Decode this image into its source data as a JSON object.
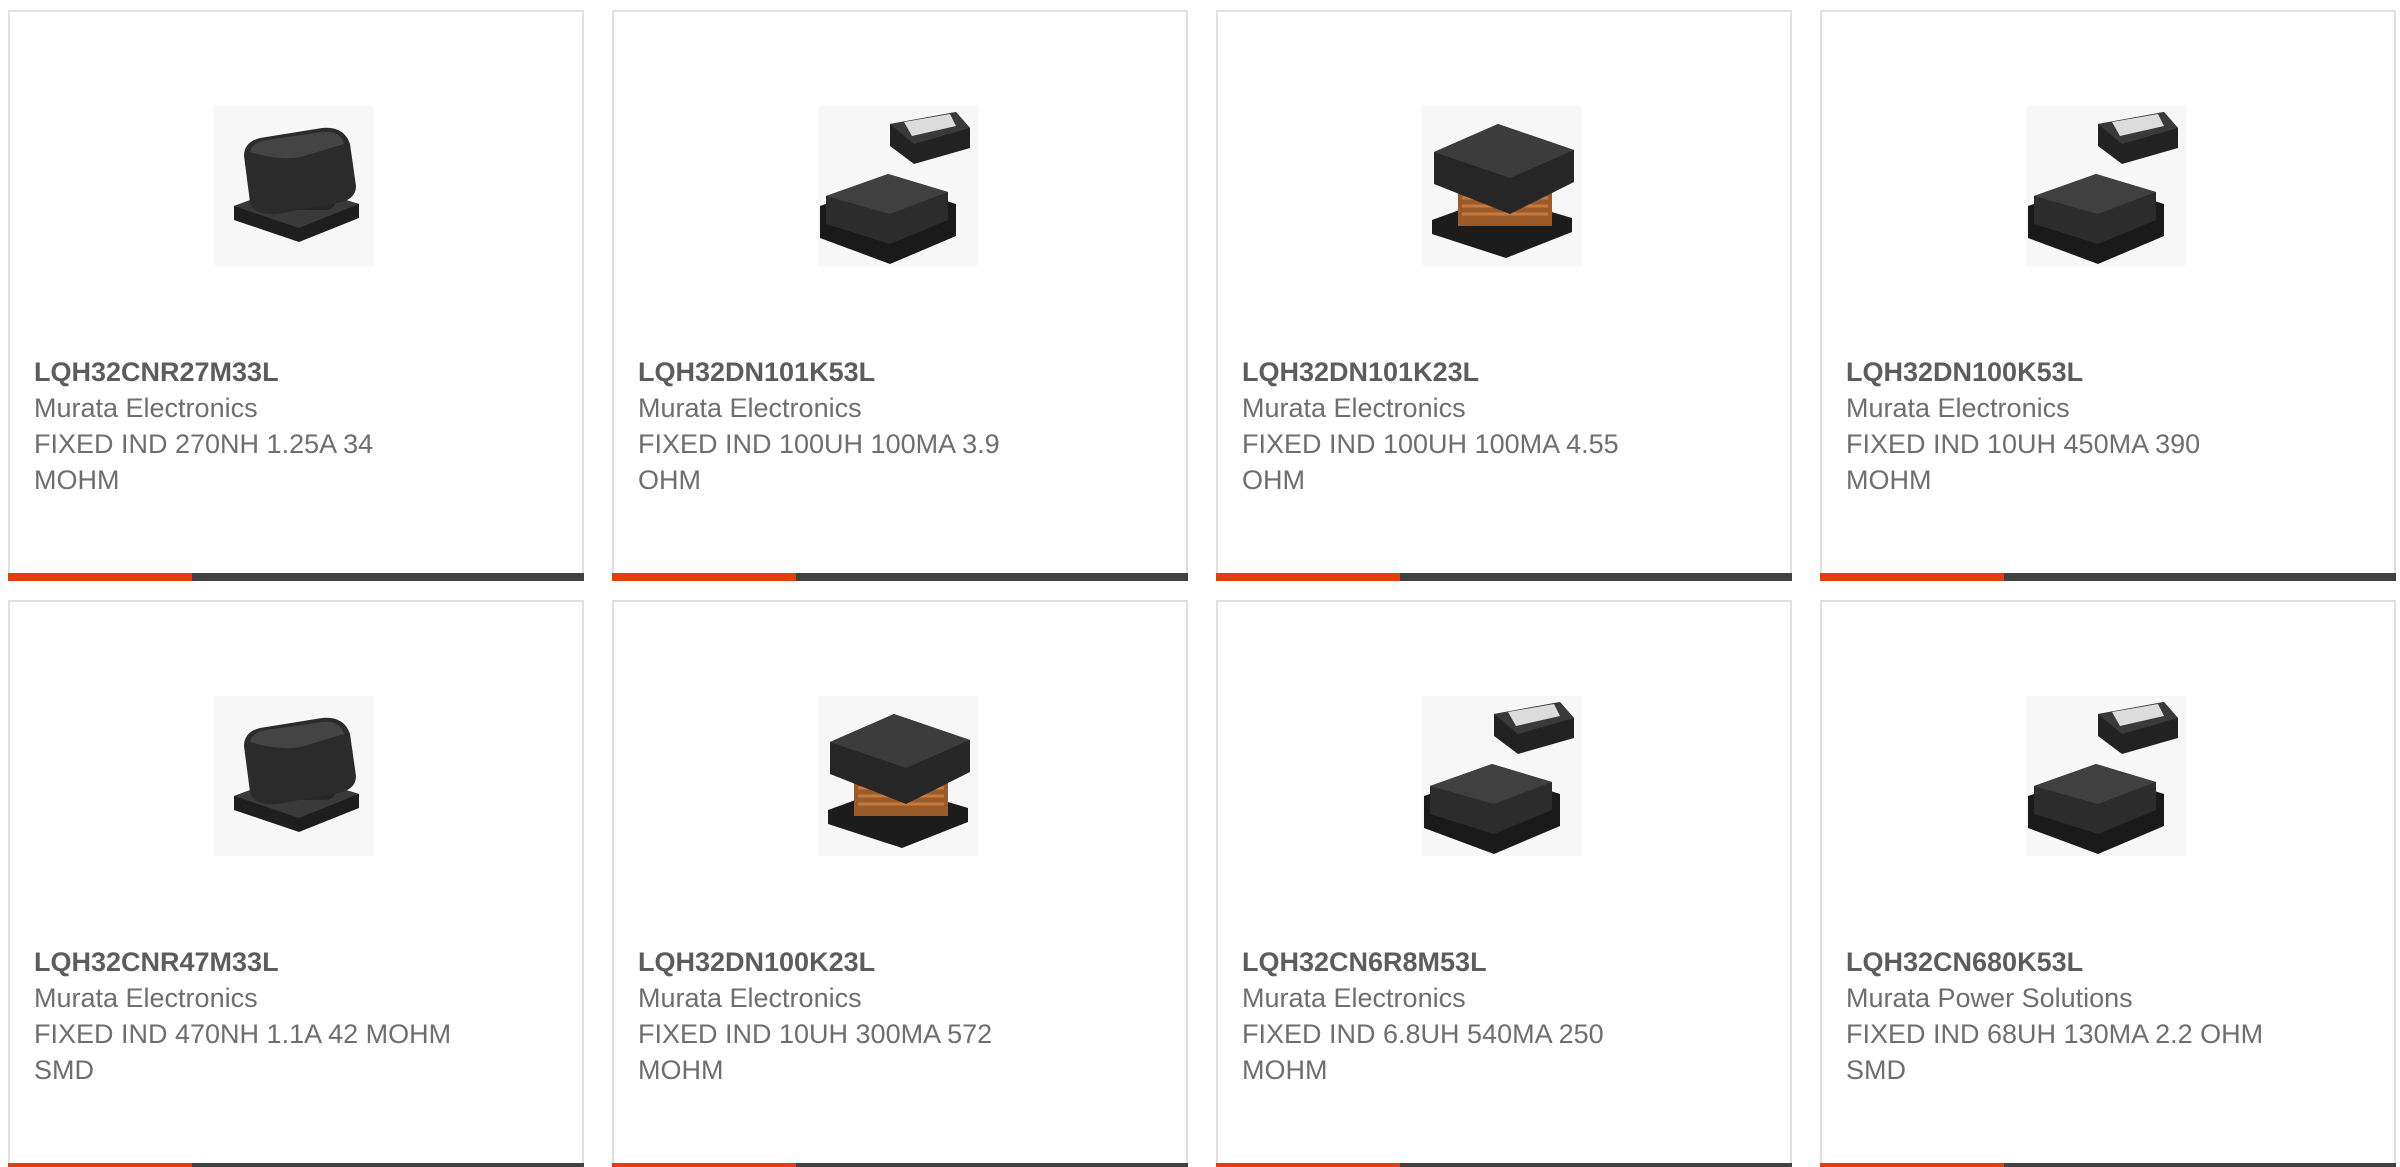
{
  "colors": {
    "accent": "#e23e0d",
    "bar": "#414141",
    "text": "#6e6e6e",
    "border": "#e0e0e0"
  },
  "products": [
    {
      "part_number": "LQH32CNR27M33L",
      "manufacturer": "Murata Electronics",
      "description": "FIXED IND 270NH 1.25A 34 MOHM",
      "image": "stacked-inductor-icon"
    },
    {
      "part_number": "LQH32DN101K53L",
      "manufacturer": "Murata Electronics",
      "description": "FIXED IND 100UH 100MA 3.9 OHM",
      "image": "inductor-pair-icon"
    },
    {
      "part_number": "LQH32DN101K23L",
      "manufacturer": "Murata Electronics",
      "description": "FIXED IND 100UH 100MA 4.55 OHM",
      "image": "wound-inductor-icon"
    },
    {
      "part_number": "LQH32DN100K53L",
      "manufacturer": "Murata Electronics",
      "description": "FIXED IND 10UH 450MA 390 MOHM",
      "image": "inductor-pair-icon"
    },
    {
      "part_number": "LQH32CNR47M33L",
      "manufacturer": "Murata Electronics",
      "description": "FIXED IND 470NH 1.1A 42 MOHM SMD",
      "image": "stacked-inductor-icon"
    },
    {
      "part_number": "LQH32DN100K23L",
      "manufacturer": "Murata Electronics",
      "description": "FIXED IND 10UH 300MA 572 MOHM",
      "image": "wound-inductor-icon"
    },
    {
      "part_number": "LQH32CN6R8M53L",
      "manufacturer": "Murata Electronics",
      "description": "FIXED IND 6.8UH 540MA 250 MOHM",
      "image": "inductor-pair-icon"
    },
    {
      "part_number": "LQH32CN680K53L",
      "manufacturer": "Murata Power Solutions",
      "description": "FIXED IND 68UH 130MA 2.2 OHM SMD",
      "image": "inductor-pair-icon"
    }
  ]
}
